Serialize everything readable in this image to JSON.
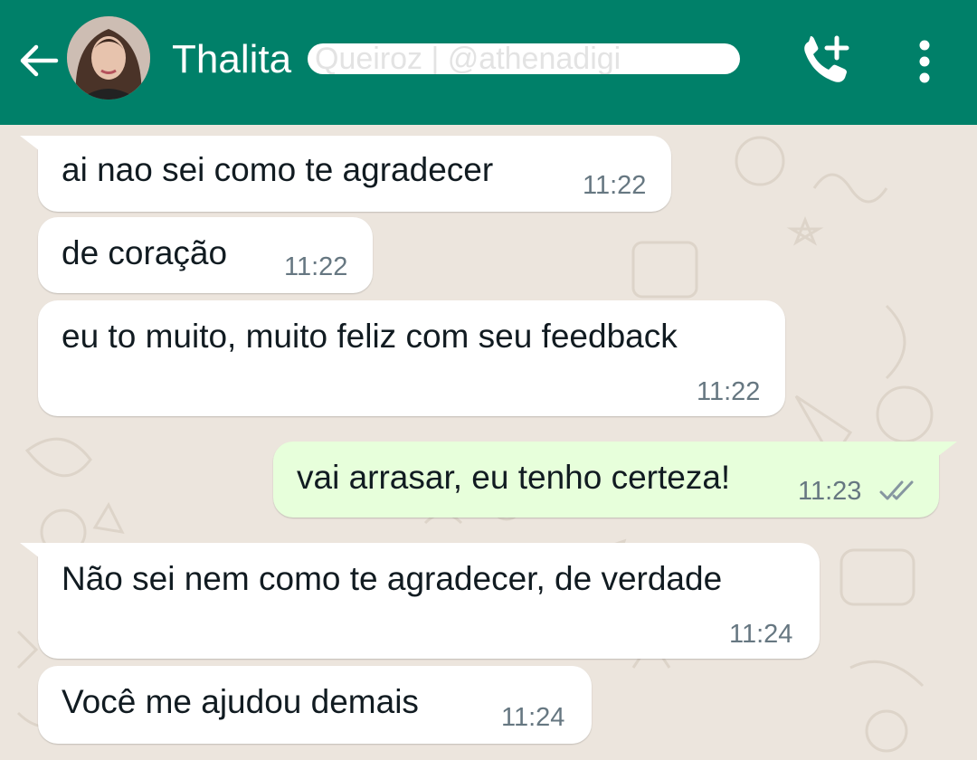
{
  "header": {
    "contact_name": "Thalita",
    "contact_name_redacted": "Queiroz | @athenadigi",
    "bg_color": "#008069"
  },
  "icons": {
    "back": "arrow-left-icon",
    "call": "add-call-icon",
    "menu": "more-vertical-icon",
    "read_receipt": "double-check-icon"
  },
  "messages": [
    {
      "direction": "incoming",
      "text": "ai nao sei como te agradecer",
      "time": "11:22"
    },
    {
      "direction": "incoming",
      "text": "de coração",
      "time": "11:22"
    },
    {
      "direction": "incoming",
      "text": "eu to muito, muito feliz com seu feedback",
      "time": "11:22"
    },
    {
      "direction": "outgoing",
      "text": "vai arrasar, eu tenho certeza!",
      "time": "11:23",
      "status": "read"
    },
    {
      "direction": "incoming",
      "text": "Não sei nem como te agradecer, de verdade",
      "time": "11:24"
    },
    {
      "direction": "incoming",
      "text": "Você me ajudou demais",
      "time": "11:24"
    }
  ],
  "colors": {
    "incoming_bubble": "#ffffff",
    "outgoing_bubble": "#e7ffdb",
    "chat_background": "#ece5dd",
    "timestamp": "#667781"
  }
}
